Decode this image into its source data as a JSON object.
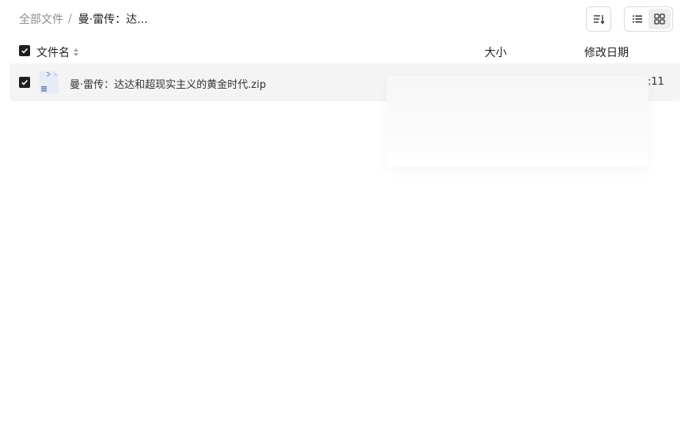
{
  "breadcrumb": {
    "root": "全部文件",
    "separator": "/",
    "current": "曼·雷传：达..."
  },
  "toolbar": {
    "sort_icon": "sort-icon",
    "list_icon": "list-view-icon",
    "grid_icon": "grid-view-icon"
  },
  "table": {
    "headers": {
      "name": "文件名",
      "size": "大小",
      "date": "修改日期"
    },
    "rows": [
      {
        "name": "曼·雷传：达达和超现实主义的黄金时代.zip",
        "size": ".  -",
        "date": ":11",
        "selected": true,
        "icon": "zip-file-icon"
      }
    ]
  },
  "colors": {
    "accent": "#1f1f1f",
    "row_bg": "#f4f4f4",
    "muted": "#8c8c8c"
  }
}
